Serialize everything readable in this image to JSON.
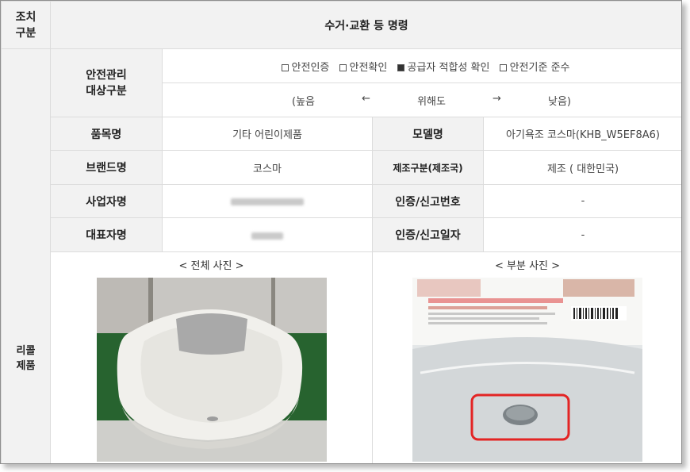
{
  "header": {
    "action_label": "조치\n구분",
    "action_value": "수거·교환 등 명령"
  },
  "side_label": "리콜\n제품",
  "safety": {
    "label": "안전관리\n대상구분",
    "options": [
      {
        "label": "안전인증",
        "checked": false
      },
      {
        "label": "안전확인",
        "checked": false
      },
      {
        "label": "공급자 적합성 확인",
        "checked": true
      },
      {
        "label": "안전기준 준수",
        "checked": false
      }
    ],
    "scale_high": "(높음",
    "arrow_left": "←",
    "scale_mid": "위해도",
    "arrow_right": "→",
    "scale_low": "낮음)"
  },
  "rows": {
    "product_name_label": "품목명",
    "product_name": "기타 어린이제품",
    "model_label": "모델명",
    "model": "아기욕조 코스마(KHB_W5EF8A6)",
    "brand_label": "브랜드명",
    "brand": "코스마",
    "origin_label": "제조구분(제조국)",
    "origin": "제조 ( 대한민국)",
    "company_label": "사업자명",
    "cert_no_label": "인증/신고번호",
    "cert_no": "-",
    "rep_label": "대표자명",
    "cert_date_label": "인증/신고일자",
    "cert_date": "-"
  },
  "photos": {
    "full_caption": "< 전체 사진 >",
    "part_caption": "< 부분 사진 >"
  },
  "colors": {
    "header_bg": "#f2f2f2",
    "border": "#dcdcdc",
    "highlight": "#e32424"
  }
}
